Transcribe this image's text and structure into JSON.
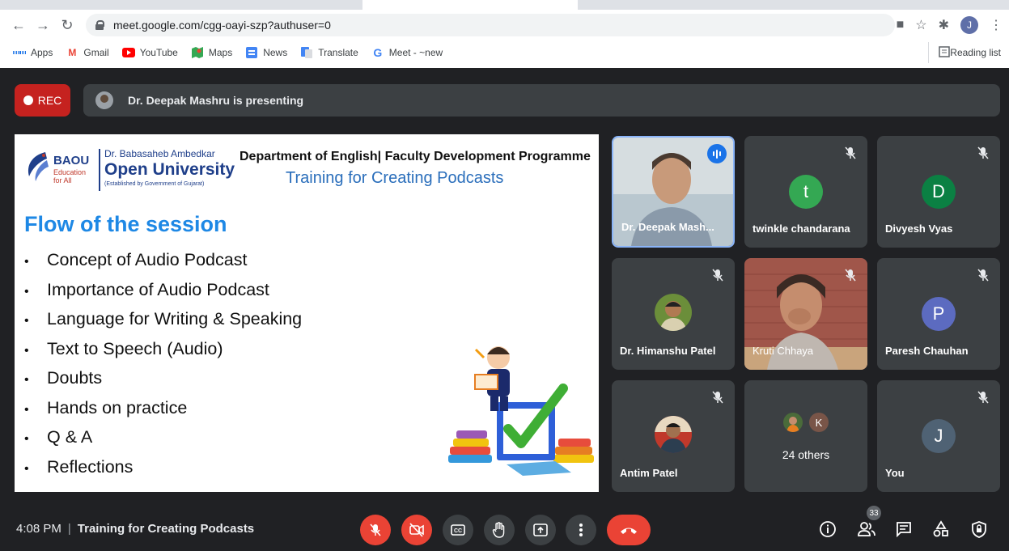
{
  "browser": {
    "url": "meet.google.com/cgg-oayi-szp?authuser=0",
    "profile_initial": "J",
    "bookmarks": [
      "Apps",
      "Gmail",
      "YouTube",
      "Maps",
      "News",
      "Translate",
      "Meet - ~new"
    ],
    "reading_list": "Reading list"
  },
  "meet": {
    "rec_label": "REC",
    "presenting_text": "Dr. Deepak Mashru is presenting",
    "time": "4:08 PM",
    "separator": "|",
    "meeting_title": "Training for Creating Podcasts",
    "participant_count": "33"
  },
  "slide": {
    "logo_abbr": "BAOU",
    "logo_tag_line1": "Education",
    "logo_tag_line2": "for All",
    "university_line1": "Dr. Babasaheb Ambedkar",
    "university_line2": "Open University",
    "university_line3": "(Established by Government of Gujarat)",
    "department": "Department of English| Faculty Development Programme",
    "training": "Training for Creating Podcasts",
    "flow_title": "Flow of the session",
    "bullets": [
      "Concept of Audio Podcast",
      "Importance of Audio Podcast",
      "Language for Writing & Speaking",
      "Text to Speech (Audio)",
      "Doubts",
      "Hands on practice",
      "Q & A",
      "Reflections"
    ]
  },
  "participants": [
    {
      "name": "Dr. Deepak Mash...",
      "type": "video"
    },
    {
      "name": "twinkle chandarana",
      "initial": "t",
      "color": "#34a853"
    },
    {
      "name": "Divyesh Vyas",
      "initial": "D",
      "color": "#0b8043"
    },
    {
      "name": "Dr. Himanshu Patel",
      "type": "photo"
    },
    {
      "name": "Kruti Chhaya",
      "type": "video"
    },
    {
      "name": "Paresh Chauhan",
      "initial": "P",
      "color": "#5c6bc0"
    },
    {
      "name": "Antim Patel",
      "type": "photo"
    },
    {
      "name": "24 others",
      "initial": "K",
      "color": "#795548"
    },
    {
      "name": "You",
      "initial": "J",
      "color": "#4f6274"
    }
  ]
}
